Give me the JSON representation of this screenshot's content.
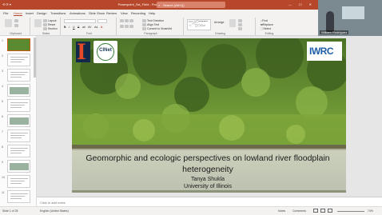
{
  "window": {
    "title": "Powerpoint_Ssl_Field - PowerPoint",
    "search_placeholder": "Search (Alt+Q)",
    "controls": "—  ☐  ✕"
  },
  "ribbon": {
    "tabs": [
      "File",
      "Home",
      "Insert",
      "Design",
      "Transitions",
      "Animations",
      "Slide Show",
      "Review",
      "View",
      "Recording",
      "Help"
    ],
    "active_tab": "Home",
    "groups": [
      {
        "label": "Clipboard",
        "buttons": [
          "Paste"
        ]
      },
      {
        "label": "Slides",
        "buttons": [
          "New Slide",
          "Layout",
          "Reset",
          "Section"
        ]
      },
      {
        "label": "Font",
        "buttons": [
          "B",
          "I",
          "U",
          "S",
          "ab",
          "AV",
          "Aa",
          "A"
        ]
      },
      {
        "label": "Paragraph",
        "buttons": [
          "Text Direction",
          "Align Text",
          "Convert to SmartArt"
        ]
      },
      {
        "label": "Drawing",
        "buttons": [
          "Arrange",
          "Quick Styles",
          "Shape Fill",
          "Shape Outline",
          "Shape Effects"
        ]
      },
      {
        "label": "Editing",
        "buttons": [
          "Find",
          "Replace",
          "Select"
        ]
      }
    ]
  },
  "thumbnails": {
    "numbers": [
      "1",
      "2",
      "3",
      "4",
      "5",
      "6",
      "7",
      "8",
      "9",
      "10",
      "11"
    ],
    "selected": 1
  },
  "slide": {
    "title": "Geomorphic and ecologic perspectives on lowland river floodplain heterogeneity",
    "author": "Tanya Shukla",
    "affiliation": "University of Illinois",
    "logo_left_letter": "I",
    "logo_badge": "CINet",
    "logo_right": "IWRC",
    "colors": {
      "illinois_orange": "#e84a27",
      "iwrc_green": "#5fa83a",
      "iwrc_blue": "#1d5ea8"
    }
  },
  "notes_placeholder": "Click to add notes",
  "status": {
    "slide_info": "Slide 1 of 25",
    "language": "English (United States)",
    "notes_btn": "Notes",
    "comments_btn": "Comments",
    "zoom": "74%"
  },
  "video": {
    "participant": "William Rodriguez"
  }
}
